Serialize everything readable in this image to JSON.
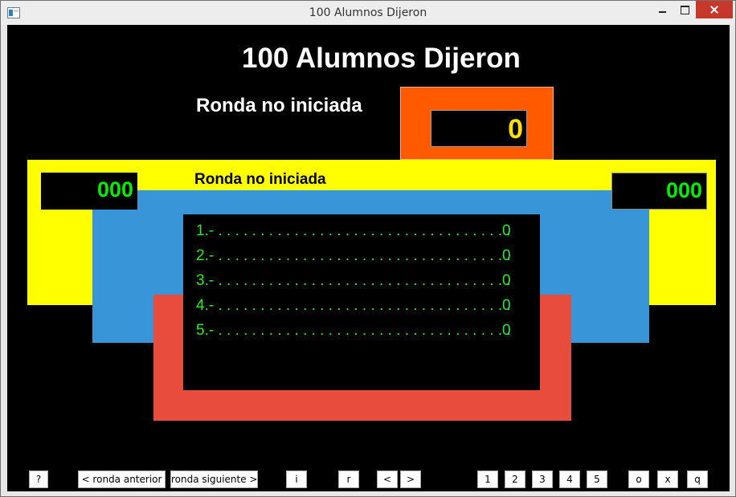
{
  "window": {
    "title": "100 Alumnos Dijeron"
  },
  "game": {
    "title": "100 Alumnos Dijeron",
    "round_status": "Ronda no iniciada",
    "pot_value": "0"
  },
  "board": {
    "label": "Ronda no iniciada",
    "team_left_score": "000",
    "team_right_score": "000",
    "answers": [
      {
        "text": "1.- . . . . . . . . . . . . . . . . . . . . . . . . . . . . . . . . . . .",
        "points": "0"
      },
      {
        "text": "2.- . . . . . . . . . . . . . . . . . . . . . . . . . . . . . . . . . . .",
        "points": "0"
      },
      {
        "text": "3.- . . . . . . . . . . . . . . . . . . . . . . . . . . . . . . . . . . .",
        "points": "0"
      },
      {
        "text": "4.- . . . . . . . . . . . . . . . . . . . . . . . . . . . . . . . . . . .",
        "points": "0"
      },
      {
        "text": "5.- . . . . . . . . . . . . . . . . . . . . . . . . . . . . . . . . . . .",
        "points": "0"
      }
    ]
  },
  "controls": {
    "help": "?",
    "prev_round": "< ronda anterior",
    "next_round": "ronda siguiente >",
    "i": "i",
    "r": "r",
    "prev": "<",
    "next": ">",
    "ans1": "1",
    "ans2": "2",
    "ans3": "3",
    "ans4": "4",
    "ans5": "5",
    "o": "o",
    "x": "x",
    "q": "q"
  },
  "colors": {
    "pot_frame": "#ff5a00",
    "board_yellow": "#ffff00",
    "board_blue": "#3896d8",
    "board_red": "#e84c3d",
    "score_green": "#00ee00",
    "pot_yellow": "#ffe000"
  },
  "icons": [
    "app-icon",
    "minimize-icon",
    "maximize-icon",
    "close-icon"
  ]
}
